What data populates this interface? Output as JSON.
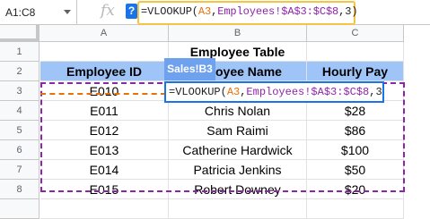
{
  "formula_bar": {
    "name_box": "A1:C8",
    "fx_icon": "fx-icon",
    "help_icon": "?",
    "formula_prefix": "=VLOOKUP(",
    "formula_ref1": "A3",
    "formula_sep1": ",",
    "formula_ref2": "Employees!$A$3:$C$8",
    "formula_suffix": ",3)"
  },
  "columns": [
    "A",
    "B",
    "C"
  ],
  "rows": [
    "1",
    "2",
    "3",
    "4",
    "5",
    "6",
    "7",
    "8"
  ],
  "table": {
    "title": "Employee Table",
    "headers": [
      "Employee ID",
      "Employee Name",
      "Hourly Pay"
    ],
    "header_name_visible": "oyee Name",
    "data": [
      [
        "E010",
        "",
        ""
      ],
      [
        "E011",
        "Chris Nolan",
        "$28"
      ],
      [
        "E012",
        "Sam Raimi",
        "$86"
      ],
      [
        "E013",
        "Catherine Hardwick",
        "$100"
      ],
      [
        "E014",
        "Patricia Jenkins",
        "$50"
      ],
      [
        "E015",
        "Robert Downey",
        "$20"
      ]
    ]
  },
  "overlay": {
    "sheet_tag": "Sales!B3",
    "edit_prefix": "=VLOOKUP(",
    "edit_ref1": "A3",
    "edit_sep1": ",",
    "edit_ref2": "Employees!$A$3:$C$8",
    "edit_suffix": ",3)"
  },
  "colors": {
    "header_fill": "#9fc5f8",
    "range_border": "#8e24aa",
    "ref_orange": "#e8710a",
    "formula_highlight": "#f4c542",
    "edit_border": "#1a73e8"
  }
}
